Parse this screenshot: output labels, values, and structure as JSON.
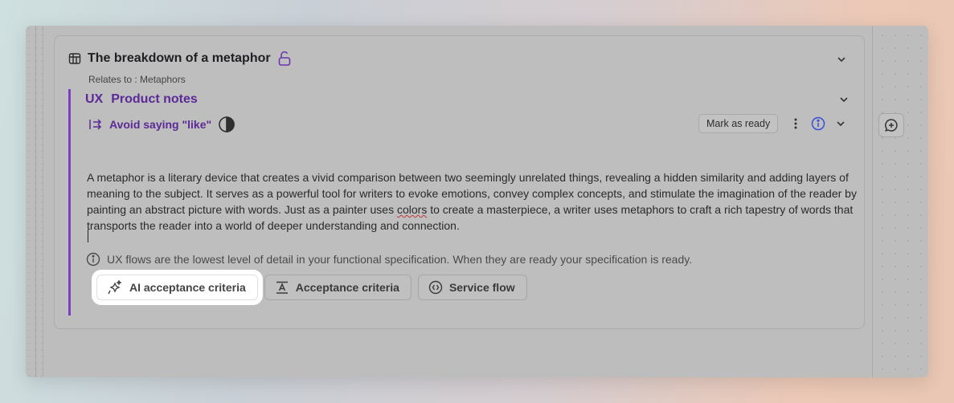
{
  "card": {
    "title": "The breakdown of a metaphor",
    "relates": "Relates to : Metaphors"
  },
  "notes": {
    "prefix": "UX",
    "title": "Product notes",
    "item_title": "Avoid saying \"like\"",
    "mark_ready": "Mark as ready",
    "text_parts": {
      "before": "A metaphor is a literary device that creates a vivid comparison between two seemingly unrelated things, revealing a hidden similarity and adding layers of meaning to the subject. It serves as a powerful tool for writers to evoke emotions, convey complex concepts, and stimulate the imagination of the reader by painting an abstract picture with words. Just as a painter uses ",
      "misspelled": "colors",
      "after": " to create a masterpiece, a writer uses metaphors to craft a rich tapestry of words that transports the reader into a world of deeper understanding and connection."
    },
    "info": "UX flows are the lowest level of detail in your functional specification. When they are ready your specification is ready."
  },
  "actions": [
    {
      "label": "AI acceptance criteria",
      "icon": "sparkle-icon"
    },
    {
      "label": "Acceptance criteria",
      "icon": "text-format-icon"
    },
    {
      "label": "Service flow",
      "icon": "flow-icon"
    }
  ],
  "colors": {
    "accent": "#5b2a96",
    "accent_bar": "#7c3fbf",
    "info_icon": "#3a4fd6"
  }
}
